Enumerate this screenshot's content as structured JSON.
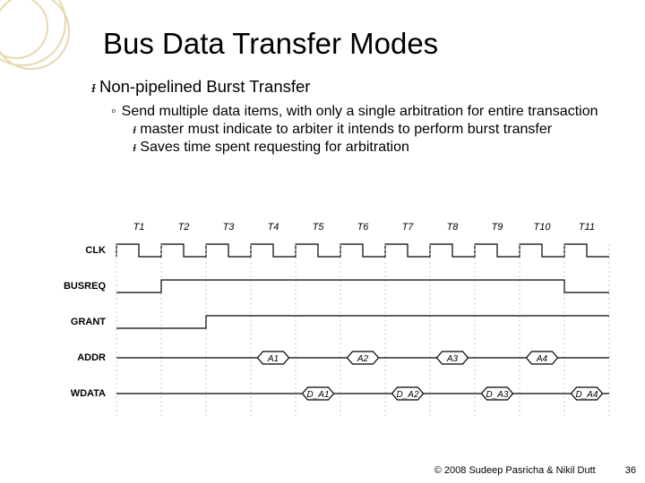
{
  "title": "Bus Data Transfer Modes",
  "main_bullet": "Non-pipelined Burst Transfer",
  "sub_bullet": "Send multiple data items, with only a single arbitration for entire transaction",
  "subsub_1": "master must indicate to arbiter it intends to perform burst transfer",
  "subsub_2": "Saves time spent requesting for arbitration",
  "chart_data": {
    "type": "timing-diagram",
    "signals": [
      "CLK",
      "BUSREQ",
      "GRANT",
      "ADDR",
      "WDATA"
    ],
    "cycles": [
      "T1",
      "T2",
      "T3",
      "T4",
      "T5",
      "T6",
      "T7",
      "T8",
      "T9",
      "T10",
      "T11"
    ],
    "BUSREQ": {
      "assert_at": 1,
      "deassert_at": 10
    },
    "GRANT": {
      "assert_at": 2,
      "deassert_at": null
    },
    "ADDR": [
      {
        "cycle": 3,
        "label": "A1"
      },
      {
        "cycle": 5,
        "label": "A2"
      },
      {
        "cycle": 7,
        "label": "A3"
      },
      {
        "cycle": 9,
        "label": "A4"
      }
    ],
    "WDATA": [
      {
        "cycle": 4,
        "label": "D_A1"
      },
      {
        "cycle": 6,
        "label": "D_A2"
      },
      {
        "cycle": 8,
        "label": "D_A3"
      },
      {
        "cycle": 10,
        "label": "D_A4"
      }
    ]
  },
  "footer": "© 2008 Sudeep Pasricha  & Nikil Dutt",
  "page_num": "36"
}
